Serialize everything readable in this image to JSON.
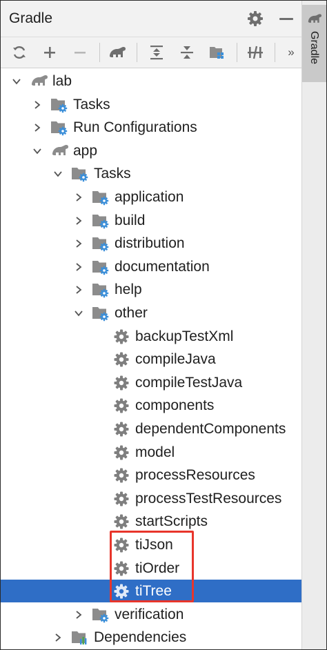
{
  "panel": {
    "title": "Gradle",
    "side_tab_label": "Gradle"
  },
  "toolbar": {
    "items": [
      {
        "name": "reload-icon"
      },
      {
        "name": "add-icon"
      },
      {
        "name": "remove-icon"
      },
      {
        "name": "execute-task-icon"
      },
      {
        "name": "expand-all-icon"
      },
      {
        "name": "collapse-all-icon"
      },
      {
        "name": "group-modules-icon"
      },
      {
        "name": "toggle-offline-icon"
      }
    ],
    "more": "»"
  },
  "tree": [
    {
      "label": "lab",
      "level": 0,
      "icon": "elephant-icon",
      "expanded": true,
      "has_children": true
    },
    {
      "label": "Tasks",
      "level": 1,
      "icon": "folder-gear-icon",
      "expanded": false,
      "has_children": true
    },
    {
      "label": "Run Configurations",
      "level": 1,
      "icon": "folder-gear-icon",
      "expanded": false,
      "has_children": true
    },
    {
      "label": "app",
      "level": 1,
      "icon": "elephant-icon",
      "expanded": true,
      "has_children": true
    },
    {
      "label": "Tasks",
      "level": 2,
      "icon": "folder-gear-icon",
      "expanded": true,
      "has_children": true
    },
    {
      "label": "application",
      "level": 3,
      "icon": "folder-gear-icon",
      "expanded": false,
      "has_children": true
    },
    {
      "label": "build",
      "level": 3,
      "icon": "folder-gear-icon",
      "expanded": false,
      "has_children": true
    },
    {
      "label": "distribution",
      "level": 3,
      "icon": "folder-gear-icon",
      "expanded": false,
      "has_children": true
    },
    {
      "label": "documentation",
      "level": 3,
      "icon": "folder-gear-icon",
      "expanded": false,
      "has_children": true
    },
    {
      "label": "help",
      "level": 3,
      "icon": "folder-gear-icon",
      "expanded": false,
      "has_children": true
    },
    {
      "label": "other",
      "level": 3,
      "icon": "folder-gear-icon",
      "expanded": true,
      "has_children": true
    },
    {
      "label": "backupTestXml",
      "level": 4,
      "icon": "gear-icon",
      "has_children": false
    },
    {
      "label": "compileJava",
      "level": 4,
      "icon": "gear-icon",
      "has_children": false
    },
    {
      "label": "compileTestJava",
      "level": 4,
      "icon": "gear-icon",
      "has_children": false
    },
    {
      "label": "components",
      "level": 4,
      "icon": "gear-icon",
      "has_children": false
    },
    {
      "label": "dependentComponents",
      "level": 4,
      "icon": "gear-icon",
      "has_children": false
    },
    {
      "label": "model",
      "level": 4,
      "icon": "gear-icon",
      "has_children": false
    },
    {
      "label": "processResources",
      "level": 4,
      "icon": "gear-icon",
      "has_children": false
    },
    {
      "label": "processTestResources",
      "level": 4,
      "icon": "gear-icon",
      "has_children": false
    },
    {
      "label": "startScripts",
      "level": 4,
      "icon": "gear-icon",
      "has_children": false
    },
    {
      "label": "tiJson",
      "level": 4,
      "icon": "gear-icon",
      "has_children": false
    },
    {
      "label": "tiOrder",
      "level": 4,
      "icon": "gear-icon",
      "has_children": false
    },
    {
      "label": "tiTree",
      "level": 4,
      "icon": "gear-icon",
      "has_children": false,
      "selected": true
    },
    {
      "label": "verification",
      "level": 3,
      "icon": "folder-gear-icon",
      "expanded": false,
      "has_children": true
    },
    {
      "label": "Dependencies",
      "level": 2,
      "icon": "folder-dependencies-icon",
      "expanded": false,
      "has_children": true
    }
  ],
  "colors": {
    "selection": "#2f6ec6",
    "highlight_box": "#e8352b",
    "gear_grey": "#7f7f7f",
    "gear_blue": "#3b8fd9",
    "folder_grey": "#8c8c8c"
  }
}
